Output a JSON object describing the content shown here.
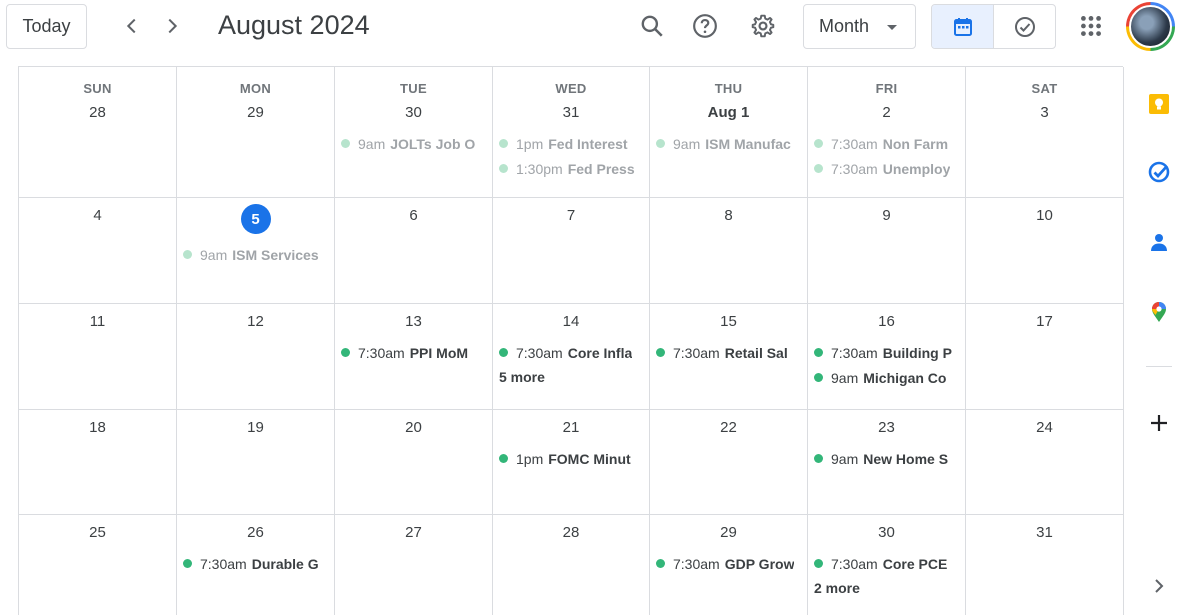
{
  "header": {
    "today_label": "Today",
    "title": "August 2024",
    "view_select": "Month",
    "icons": [
      "chevron-left-icon",
      "chevron-right-icon",
      "search-icon",
      "help-icon",
      "gear-icon",
      "calendar-icon",
      "tasks-check-icon",
      "apps-grid-icon"
    ]
  },
  "colors": {
    "accent": "#1a73e8",
    "event_dot": "#33b679",
    "event_dot_past": "#b7e4cd",
    "toggle_active": "#e8f0fe"
  },
  "weekdays": [
    "SUN",
    "MON",
    "TUE",
    "WED",
    "THU",
    "FRI",
    "SAT"
  ],
  "weeks": [
    {
      "days": [
        {
          "num": "28",
          "events": []
        },
        {
          "num": "29",
          "events": []
        },
        {
          "num": "30",
          "events": [
            {
              "time": "9am",
              "name": "JOLTs Job O"
            }
          ]
        },
        {
          "num": "31",
          "events": [
            {
              "time": "1pm",
              "name": "Fed Interest"
            },
            {
              "time": "1:30pm",
              "name": "Fed Press"
            }
          ]
        },
        {
          "num": "Aug 1",
          "events": [
            {
              "time": "9am",
              "name": "ISM Manufac"
            }
          ]
        },
        {
          "num": "2",
          "events": [
            {
              "time": "7:30am",
              "name": "Non Farm"
            },
            {
              "time": "7:30am",
              "name": "Unemploy"
            }
          ]
        },
        {
          "num": "3",
          "events": []
        }
      ]
    },
    {
      "days": [
        {
          "num": "4",
          "events": []
        },
        {
          "num": "5",
          "today": true,
          "events": [
            {
              "time": "9am",
              "name": "ISM Services"
            }
          ]
        },
        {
          "num": "6",
          "events": []
        },
        {
          "num": "7",
          "events": []
        },
        {
          "num": "8",
          "events": []
        },
        {
          "num": "9",
          "events": []
        },
        {
          "num": "10",
          "events": []
        }
      ]
    },
    {
      "days": [
        {
          "num": "11",
          "events": []
        },
        {
          "num": "12",
          "events": []
        },
        {
          "num": "13",
          "events": [
            {
              "time": "7:30am",
              "name": "PPI MoM"
            }
          ]
        },
        {
          "num": "14",
          "events": [
            {
              "time": "7:30am",
              "name": "Core Infla"
            }
          ],
          "more": "5 more"
        },
        {
          "num": "15",
          "events": [
            {
              "time": "7:30am",
              "name": "Retail Sal"
            }
          ]
        },
        {
          "num": "16",
          "events": [
            {
              "time": "7:30am",
              "name": "Building P"
            },
            {
              "time": "9am",
              "name": "Michigan Co"
            }
          ]
        },
        {
          "num": "17",
          "events": []
        }
      ]
    },
    {
      "days": [
        {
          "num": "18",
          "events": []
        },
        {
          "num": "19",
          "events": []
        },
        {
          "num": "20",
          "events": []
        },
        {
          "num": "21",
          "events": [
            {
              "time": "1pm",
              "name": "FOMC Minut"
            }
          ]
        },
        {
          "num": "22",
          "events": []
        },
        {
          "num": "23",
          "events": [
            {
              "time": "9am",
              "name": "New Home S"
            }
          ]
        },
        {
          "num": "24",
          "events": []
        }
      ]
    },
    {
      "days": [
        {
          "num": "25",
          "events": []
        },
        {
          "num": "26",
          "events": [
            {
              "time": "7:30am",
              "name": "Durable G"
            }
          ]
        },
        {
          "num": "27",
          "events": []
        },
        {
          "num": "28",
          "events": []
        },
        {
          "num": "29",
          "events": [
            {
              "time": "7:30am",
              "name": "GDP Grow"
            }
          ]
        },
        {
          "num": "30",
          "events": [
            {
              "time": "7:30am",
              "name": "Core PCE"
            }
          ],
          "more": "2 more"
        },
        {
          "num": "31",
          "events": []
        }
      ]
    }
  ],
  "side_panel": {
    "icons": [
      "keep-icon",
      "tasks-icon",
      "contacts-icon",
      "maps-icon",
      "add-icon",
      "chevron-right-icon"
    ]
  }
}
